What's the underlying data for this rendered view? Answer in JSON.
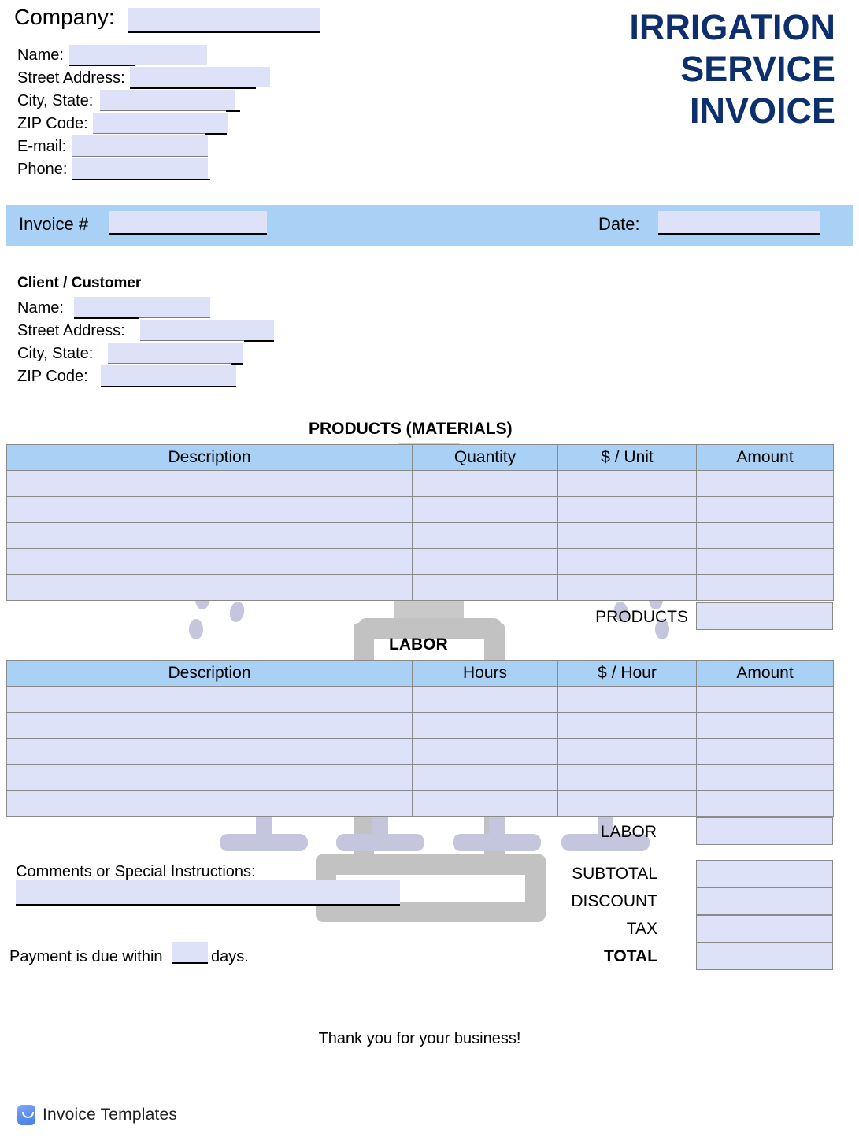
{
  "title": {
    "line1": "IRRIGATION",
    "line2": "SERVICE",
    "line3": "INVOICE"
  },
  "company": {
    "company_label": "Company:",
    "fields": [
      {
        "label": "Name:",
        "value": ""
      },
      {
        "label": "Street Address:",
        "value": ""
      },
      {
        "label": "City, State:",
        "value": ""
      },
      {
        "label": "ZIP Code:",
        "value": ""
      },
      {
        "label": "E-mail:",
        "value": ""
      },
      {
        "label": "Phone:",
        "value": ""
      }
    ]
  },
  "invoice_bar": {
    "invoice_number_label": "Invoice #",
    "invoice_number_value": "",
    "date_label": "Date:",
    "date_value": ""
  },
  "client": {
    "heading": "Client / Customer",
    "fields": [
      {
        "label": "Name:",
        "value": ""
      },
      {
        "label": "Street Address:",
        "value": ""
      },
      {
        "label": "City, State:",
        "value": ""
      },
      {
        "label": "ZIP Code:",
        "value": ""
      }
    ]
  },
  "products": {
    "section_title": "PRODUCTS (MATERIALS)",
    "columns": [
      "Description",
      "Quantity",
      "$ / Unit",
      "Amount"
    ],
    "rows": [
      [
        "",
        "",
        "",
        ""
      ],
      [
        "",
        "",
        "",
        ""
      ],
      [
        "",
        "",
        "",
        ""
      ],
      [
        "",
        "",
        "",
        ""
      ],
      [
        "",
        "",
        "",
        ""
      ]
    ],
    "total_label": "PRODUCTS",
    "total_value": ""
  },
  "labor": {
    "section_title": "LABOR",
    "columns": [
      "Description",
      "Hours",
      "$ / Hour",
      "Amount"
    ],
    "rows": [
      [
        "",
        "",
        "",
        ""
      ],
      [
        "",
        "",
        "",
        ""
      ],
      [
        "",
        "",
        "",
        ""
      ],
      [
        "",
        "",
        "",
        ""
      ],
      [
        "",
        "",
        "",
        ""
      ]
    ],
    "total_label": "LABOR",
    "total_value": ""
  },
  "summary": {
    "rows": [
      {
        "label": "SUBTOTAL",
        "value": ""
      },
      {
        "label": "DISCOUNT",
        "value": ""
      },
      {
        "label": "TAX",
        "value": ""
      },
      {
        "label": "TOTAL",
        "value": ""
      }
    ]
  },
  "comments": {
    "label": "Comments or Special Instructions:",
    "value": ""
  },
  "payment_terms": {
    "prefix": "Payment is due within",
    "days_value": "",
    "suffix": "days."
  },
  "footer": {
    "thanks": "Thank you for your business!",
    "brand": "Invoice Templates"
  },
  "colors": {
    "title_navy": "#0d2f6e",
    "bar_blue": "#a8d1f5",
    "field_fill": "#dee2f8",
    "watermark_gray": "#c6c6c6"
  }
}
